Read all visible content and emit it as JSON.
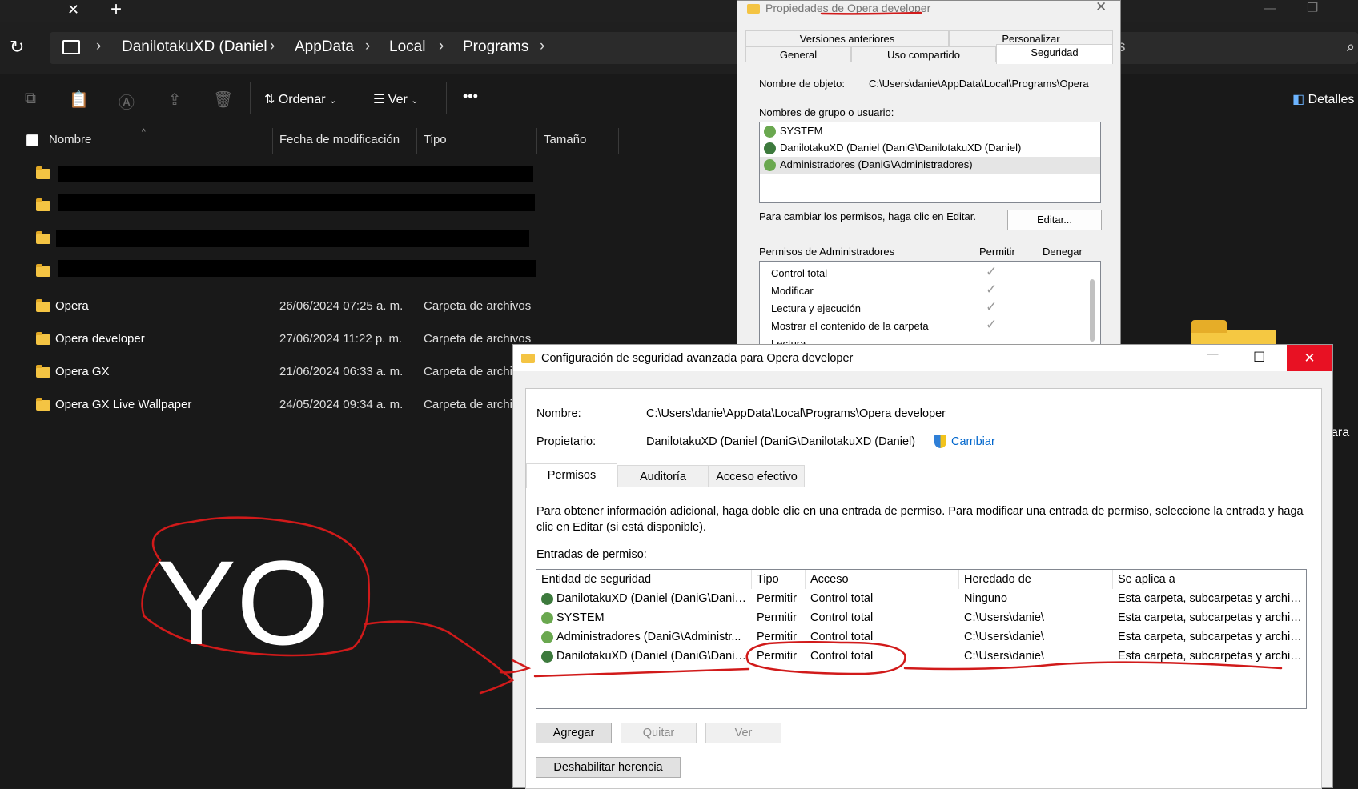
{
  "explorer": {
    "tab_close": "✕",
    "tab_new": "+",
    "breadcrumb": [
      "DanilotakuXD (Daniel",
      "AppData",
      "Local",
      "Programs"
    ],
    "toolbar": {
      "sort_label": "Ordenar",
      "view_label": "Ver",
      "more": "•••",
      "details_label": "Detalles"
    },
    "columns": [
      "Nombre",
      "Fecha de modificación",
      "Tipo",
      "Tamaño"
    ],
    "rows": [
      {
        "name": "",
        "date": "",
        "type": ""
      },
      {
        "name": "",
        "date": "",
        "type": ""
      },
      {
        "name": "",
        "date": "",
        "type": ""
      },
      {
        "name": "",
        "date": "",
        "type": ""
      },
      {
        "name": "Opera",
        "date": "26/06/2024 07:25 a. m.",
        "type": "Carpeta de archivos"
      },
      {
        "name": "Opera developer",
        "date": "27/06/2024 11:22 p. m.",
        "type": "Carpeta de archivos"
      },
      {
        "name": "Opera GX",
        "date": "21/06/2024 06:33 a. m.",
        "type": "Carpeta de archi"
      },
      {
        "name": "Opera GX Live Wallpaper",
        "date": "24/05/2024 09:34 a. m.",
        "type": "Carpeta de archi"
      }
    ],
    "partial_right_text_1": "s",
    "partial_right_text_2": "ara"
  },
  "properties": {
    "title": "Propiedades de Opera developer",
    "close": "✕",
    "tabs_top": [
      "Versiones anteriores",
      "Personalizar"
    ],
    "tabs_bottom": [
      "General",
      "Uso compartido",
      "Seguridad"
    ],
    "object_label": "Nombre de objeto:",
    "object_value": "C:\\Users\\danie\\AppData\\Local\\Programs\\Opera",
    "groups_label": "Nombres de grupo o usuario:",
    "groups": [
      "SYSTEM",
      "DanilotakuXD (Daniel (DaniG\\DanilotakuXD (Daniel)",
      "Administradores (DaniG\\Administradores)"
    ],
    "change_hint": "Para cambiar los permisos, haga clic en Editar.",
    "edit_button": "Editar...",
    "perms_label": "Permisos de Administradores",
    "allow_label": "Permitir",
    "deny_label": "Denegar",
    "perms": [
      "Control total",
      "Modificar",
      "Lectura y ejecución",
      "Mostrar el contenido de la carpeta",
      "Lectura"
    ]
  },
  "advanced": {
    "title": "Configuración de seguridad avanzada para Opera developer",
    "minimize": "—",
    "maximize": "☐",
    "close": "✕",
    "name_label": "Nombre:",
    "name_value": "C:\\Users\\danie\\AppData\\Local\\Programs\\Opera developer",
    "owner_label": "Propietario:",
    "owner_value": "DanilotakuXD (Daniel (DaniG\\DanilotakuXD (Daniel)",
    "change_link": "Cambiar",
    "tabs": [
      "Permisos",
      "Auditoría",
      "Acceso efectivo"
    ],
    "info": "Para obtener información adicional, haga doble clic en una entrada de permiso. Para modificar una entrada de permiso, seleccione la entrada y haga clic en Editar (si está disponible).",
    "entries_label": "Entradas de permiso:",
    "table_headers": [
      "Entidad de seguridad",
      "Tipo",
      "Acceso",
      "Heredado de",
      "Se aplica a"
    ],
    "table_rows": [
      {
        "entity": "DanilotakuXD (Daniel (DaniG\\Danilot...",
        "type": "Permitir",
        "access": "Control total",
        "inherited": "Ninguno",
        "applies": "Esta carpeta, subcarpetas y archiv..."
      },
      {
        "entity": "SYSTEM",
        "type": "Permitir",
        "access": "Control total",
        "inherited": "C:\\Users\\danie\\",
        "applies": "Esta carpeta, subcarpetas y archiv..."
      },
      {
        "entity": "Administradores (DaniG\\Administr...",
        "type": "Permitir",
        "access": "Control total",
        "inherited": "C:\\Users\\danie\\",
        "applies": "Esta carpeta, subcarpetas y archiv..."
      },
      {
        "entity": "DanilotakuXD (Daniel (DaniG\\Danilot...",
        "type": "Permitir",
        "access": "Control total",
        "inherited": "C:\\Users\\danie\\",
        "applies": "Esta carpeta, subcarpetas y archiv..."
      }
    ],
    "buttons": [
      "Agregar",
      "Quitar",
      "Ver"
    ],
    "disable_inheritance": "Deshabilitar herencia"
  },
  "annotation": {
    "text": "YO",
    "color": "#d11a1a"
  }
}
